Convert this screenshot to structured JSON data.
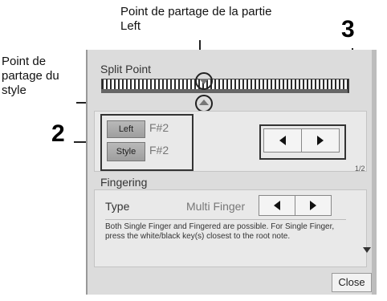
{
  "annotations": {
    "left_part_split": "Point de partage de la partie Left",
    "style_split": "Point de partage du style",
    "num_2": "2",
    "num_3": "3"
  },
  "split_point": {
    "title": "Split Point",
    "left_button": "Left",
    "left_note": "F#2",
    "style_button": "Style",
    "style_note": "F#2",
    "prev_icon": "triangle-left",
    "next_icon": "triangle-right"
  },
  "page_indicator": "1/2",
  "fingering": {
    "title": "Fingering",
    "type_label": "Type",
    "type_value": "Multi Finger",
    "description": "Both Single Finger and Fingered are possible. For Single Finger, press the white/black key(s) closest to the root note."
  },
  "close_label": "Close"
}
